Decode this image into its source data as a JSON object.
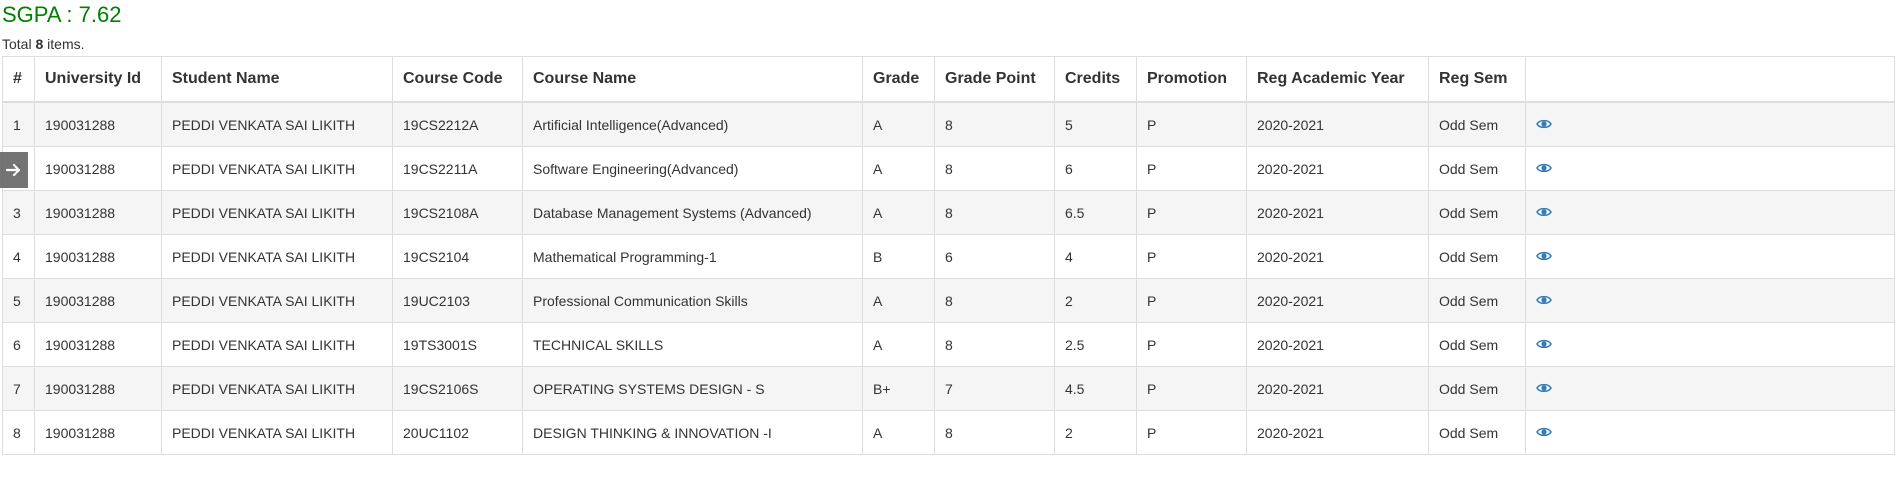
{
  "summary": {
    "sgpa_text": "SGPA : 7.62",
    "total_prefix": "Total ",
    "total_count": "8",
    "total_suffix": " items."
  },
  "table": {
    "headers": [
      "#",
      "University Id",
      "Student Name",
      "Course Code",
      "Course Name",
      "Grade",
      "Grade Point",
      "Credits",
      "Promotion",
      "Reg Academic Year",
      "Reg Sem",
      ""
    ],
    "rows": [
      {
        "num": "1",
        "uid": "190031288",
        "name": "PEDDI VENKATA SAI LIKITH",
        "code": "19CS2212A",
        "course": "Artificial Intelligence(Advanced)",
        "grade": "A",
        "gp": "8",
        "credits": "5",
        "promotion": "P",
        "year": "2020-2021",
        "sem": "Odd Sem"
      },
      {
        "num": "2",
        "uid": "190031288",
        "name": "PEDDI VENKATA SAI LIKITH",
        "code": "19CS2211A",
        "course": "Software Engineering(Advanced)",
        "grade": "A",
        "gp": "8",
        "credits": "6",
        "promotion": "P",
        "year": "2020-2021",
        "sem": "Odd Sem"
      },
      {
        "num": "3",
        "uid": "190031288",
        "name": "PEDDI VENKATA SAI LIKITH",
        "code": "19CS2108A",
        "course": "Database Management Systems (Advanced)",
        "grade": "A",
        "gp": "8",
        "credits": "6.5",
        "promotion": "P",
        "year": "2020-2021",
        "sem": "Odd Sem"
      },
      {
        "num": "4",
        "uid": "190031288",
        "name": "PEDDI VENKATA SAI LIKITH",
        "code": "19CS2104",
        "course": "Mathematical Programming-1",
        "grade": "B",
        "gp": "6",
        "credits": "4",
        "promotion": "P",
        "year": "2020-2021",
        "sem": "Odd Sem"
      },
      {
        "num": "5",
        "uid": "190031288",
        "name": "PEDDI VENKATA SAI LIKITH",
        "code": "19UC2103",
        "course": "Professional Communication Skills",
        "grade": "A",
        "gp": "8",
        "credits": "2",
        "promotion": "P",
        "year": "2020-2021",
        "sem": "Odd Sem"
      },
      {
        "num": "6",
        "uid": "190031288",
        "name": "PEDDI VENKATA SAI LIKITH",
        "code": "19TS3001S",
        "course": "TECHNICAL SKILLS",
        "grade": "A",
        "gp": "8",
        "credits": "2.5",
        "promotion": "P",
        "year": "2020-2021",
        "sem": "Odd Sem"
      },
      {
        "num": "7",
        "uid": "190031288",
        "name": "PEDDI VENKATA SAI LIKITH",
        "code": "19CS2106S",
        "course": "OPERATING SYSTEMS DESIGN - S",
        "grade": "B+",
        "gp": "7",
        "credits": "4.5",
        "promotion": "P",
        "year": "2020-2021",
        "sem": "Odd Sem"
      },
      {
        "num": "8",
        "uid": "190031288",
        "name": "PEDDI VENKATA SAI LIKITH",
        "code": "20UC1102",
        "course": "DESIGN THINKING & INNOVATION -I",
        "grade": "A",
        "gp": "8",
        "credits": "2",
        "promotion": "P",
        "year": "2020-2021",
        "sem": "Odd Sem"
      }
    ],
    "row_action_icon": "eye-icon"
  },
  "overlay": {
    "icon": "arrow-right-icon"
  },
  "colors": {
    "sgpa": "#008000",
    "eye_icon": "#337ab7",
    "stripe": "#f5f5f5",
    "border": "#dddddd"
  }
}
